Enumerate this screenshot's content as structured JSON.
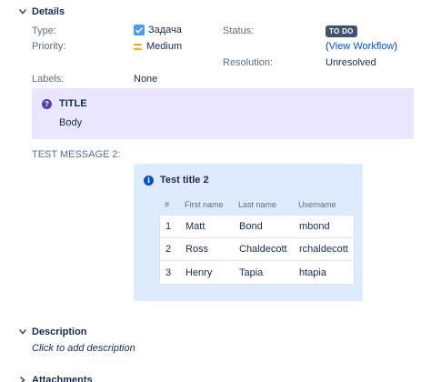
{
  "details": {
    "heading": "Details",
    "fields": {
      "type_label": "Type:",
      "type_value": "Задача",
      "status_label": "Status:",
      "status_value": "TO DO",
      "priority_label": "Priority:",
      "priority_value": "Medium",
      "workflow_open": "(",
      "workflow_link": "View Workflow",
      "workflow_close": ")",
      "resolution_label": "Resolution:",
      "resolution_value": "Unresolved",
      "labels_label": "Labels:",
      "labels_value": "None"
    }
  },
  "note_panel": {
    "title": "TITLE",
    "body": "Body"
  },
  "test_message": {
    "label": "TEST MESSAGE 2:",
    "panel_title": "Test title 2",
    "columns": [
      "#",
      "First name",
      "Last name",
      "Username"
    ],
    "rows": [
      [
        "1",
        "Matt",
        "Bond",
        "mbond"
      ],
      [
        "2",
        "Ross",
        "Chaldecott",
        "rchaldecott"
      ],
      [
        "3",
        "Henry",
        "Tapia",
        "htapia"
      ]
    ]
  },
  "description": {
    "heading": "Description",
    "placeholder": "Click to add description"
  },
  "attachments": {
    "heading": "Attachments"
  },
  "colors": {
    "accent_blue": "#0052cc",
    "note_bg": "#eae6ff",
    "info_bg": "#deebff",
    "status_badge": "#42526e",
    "priority_medium": "#ffab00"
  },
  "icons": {
    "collapse": "chevron-down-icon",
    "expand": "chevron-right-icon",
    "type": "checkbox-icon",
    "priority": "priority-medium-icon",
    "note": "question-circle-icon",
    "info": "info-circle-icon"
  }
}
